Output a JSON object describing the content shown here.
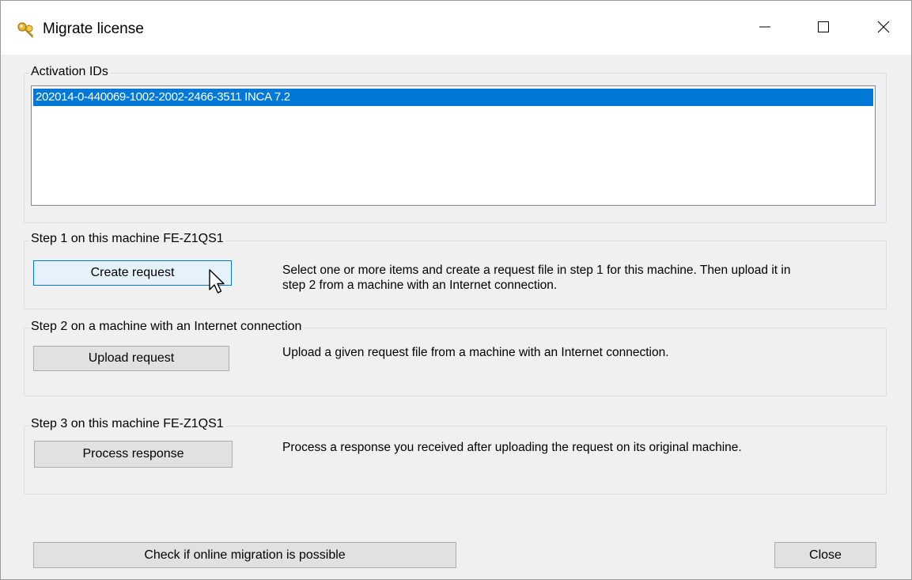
{
  "window": {
    "title": "Migrate license"
  },
  "activation": {
    "group_label": "Activation IDs",
    "items": [
      {
        "text": "202014-0-440069-1002-2002-2466-3511 INCA 7.2",
        "selected": true
      }
    ]
  },
  "step1": {
    "group_label": "Step 1 on this machine FE-Z1QS1",
    "button_label": "Create request",
    "description_line1": "Select one or more items and create a request file in step 1 for this machine.  Then upload it in",
    "description_line2": "step 2 from a machine with an Internet connection."
  },
  "step2": {
    "group_label": "Step 2 on a machine with an Internet connection",
    "button_label": "Upload request",
    "description": "Upload a given request file from a machine with an Internet connection."
  },
  "step3": {
    "group_label": "Step 3 on this machine FE-Z1QS1",
    "button_label": "Process response",
    "description": "Process a response you received after uploading the request on its original machine."
  },
  "footer": {
    "check_button_label": "Check if online migration is possible",
    "close_button_label": "Close"
  },
  "colors": {
    "selection": "#0078d7",
    "hover_button": "#e5f1fb",
    "dialog_background": "#f0f0f0"
  },
  "icons": {
    "app": "key-icon",
    "minimize": "minimize-icon",
    "maximize": "maximize-icon",
    "close": "close-icon",
    "cursor": "mouse-pointer-icon"
  }
}
